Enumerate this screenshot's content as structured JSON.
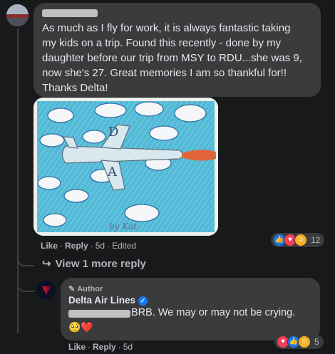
{
  "comment": {
    "text": "As much as I fly for work, it is always fantastic taking\nmy kids on a trip. Found this recently - done by my\ndaughter before our trip from MSY to RDU...she was 9,\nnow she's 27. Great memories I am so thankful for!!\nThanks Delta!",
    "actions": {
      "like": "Like",
      "reply": "Reply",
      "time": "5d",
      "edited": "Edited"
    },
    "reaction_count": "12",
    "drawing": {
      "letter_top": "D",
      "letter_bottom": "A",
      "signature": "by Kat"
    }
  },
  "thread": {
    "view_more": "View 1 more reply"
  },
  "reply": {
    "author_badge": "Author",
    "name": "Delta Air Lines",
    "text": "BRB. We may or may not be crying.",
    "emoji": "🥺❤️",
    "actions": {
      "like": "Like",
      "reply": "Reply",
      "time": "5d"
    },
    "reaction_count": "5"
  },
  "colors": {
    "background": "#18191a",
    "bubble": "#3a3b3c",
    "like": "#1877f2",
    "love": "#f33e58",
    "care": "#f7b125"
  }
}
